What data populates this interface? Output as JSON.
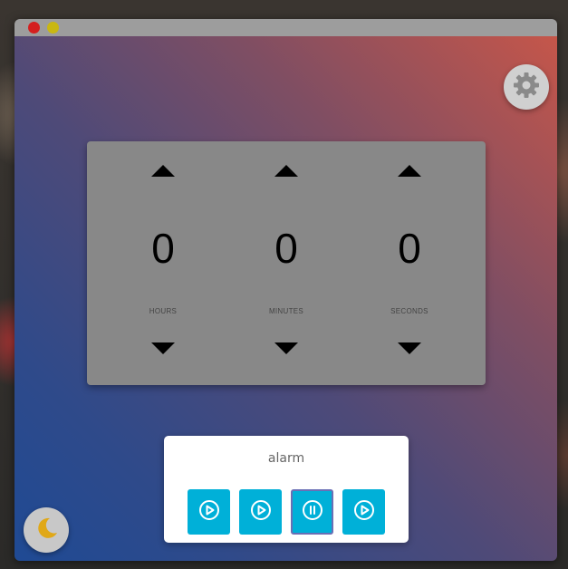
{
  "window": {
    "controls": [
      "close",
      "minimize"
    ]
  },
  "settings": {
    "icon": "gear-icon"
  },
  "theme_toggle": {
    "icon": "moon-icon"
  },
  "timer": {
    "units": [
      {
        "key": "hours",
        "value": "0",
        "label": "HOURS"
      },
      {
        "key": "minutes",
        "value": "0",
        "label": "MINUTES"
      },
      {
        "key": "seconds",
        "value": "0",
        "label": "SECONDS"
      }
    ]
  },
  "sound": {
    "title": "alarm",
    "buttons": [
      {
        "icon": "play-icon",
        "state": "stopped"
      },
      {
        "icon": "play-icon",
        "state": "stopped"
      },
      {
        "icon": "pause-icon",
        "state": "playing"
      },
      {
        "icon": "play-icon",
        "state": "stopped"
      }
    ]
  },
  "colors": {
    "accent": "#00b0d8",
    "panel": "#888888",
    "close": "#d41f1f",
    "minimize": "#c9b712"
  }
}
